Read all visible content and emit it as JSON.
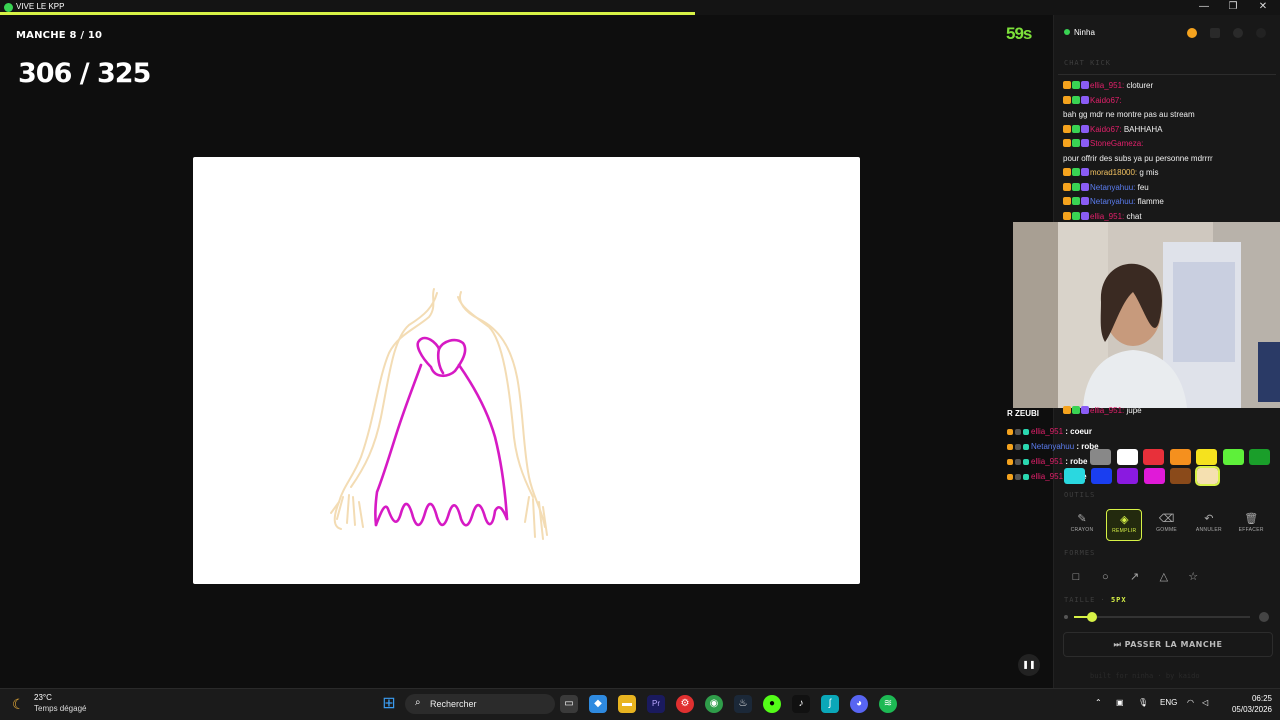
{
  "window": {
    "title": "VIVE LE KPP",
    "progress": 0.543
  },
  "game": {
    "round_label": "MANCHE 8 / 10",
    "timer": "59s",
    "score": "306 / 325"
  },
  "panel": {
    "streamer": "Ninha",
    "chat_title": "CHAT KICK",
    "chat": [
      {
        "user": "ellia_951:",
        "text": " cloturer",
        "color": "#e0206a"
      },
      {
        "user": "Kaido67:",
        "text": "",
        "color": "#e0206a"
      },
      {
        "user": "",
        "text": "bah gg mdr ne montre pas au stream",
        "color": "#e0206a"
      },
      {
        "user": "Kaido67:",
        "text": " BAHHAHA",
        "color": "#e0206a"
      },
      {
        "user": "StoneGameza:",
        "text": "",
        "color": "#e0206a"
      },
      {
        "user": "",
        "text": "pour offrir des subs ya pu personne mdrrrr",
        "color": "#e0206a"
      },
      {
        "user": "morad18000:",
        "text": " g mis",
        "color": "#f0c060"
      },
      {
        "user": "Netanyahuu:",
        "text": " feu",
        "color": "#5b7df0"
      },
      {
        "user": "Netanyahuu:",
        "text": " flamme",
        "color": "#5b7df0"
      },
      {
        "user": "ellia_951:",
        "text": " chat",
        "color": "#e0206a"
      }
    ],
    "last_chat": {
      "user": "ellia_951:",
      "text": " jupe"
    },
    "guesses_title": "R ZEUBI",
    "guesses": [
      {
        "user": "ellia_951",
        "text": " : coeur",
        "color": "#e0206a"
      },
      {
        "user": "Netanyahuu",
        "text": " : robe",
        "color": "#5b7df0"
      },
      {
        "user": "ellia_951",
        "text": " : robe",
        "color": "#e0206a"
      },
      {
        "user": "ellia_951",
        "text": " : jupe",
        "color": "#e0206a"
      }
    ],
    "palette": {
      "row1": [
        "#888888",
        "#ffffff",
        "#e8303a",
        "#f5901e",
        "#f5e21e",
        "#5ef03a",
        "#1a9e2a"
      ],
      "row2": [
        "#2ad8e0",
        "#1a3ef0",
        "#8a1ae0",
        "#e01ad8",
        "#8a4a1a",
        "#f5e0b0"
      ]
    },
    "tools_title": "OUTILS",
    "tools": [
      {
        "label": "CRAYON",
        "icon": "✎"
      },
      {
        "label": "REMPLIR",
        "icon": "◈"
      },
      {
        "label": "GOMME",
        "icon": "⌫"
      },
      {
        "label": "ANNULER",
        "icon": "↶"
      },
      {
        "label": "EFFACER",
        "icon": "🗑"
      }
    ],
    "shapes_title": "FORMES",
    "shapes": [
      "□",
      "○",
      "↗",
      "△",
      "☆"
    ],
    "size_title": "TAILLE · ",
    "size_value": "5PX",
    "skip_label": "⏭ PASSER LA MANCHE",
    "footer": "built for ninha · by kaido"
  },
  "taskbar": {
    "weather_temp": "23°C",
    "weather_desc": "Temps dégagé",
    "search_placeholder": "Rechercher",
    "lang": "ENG",
    "time": "06:25",
    "date": "05/03/2026"
  }
}
